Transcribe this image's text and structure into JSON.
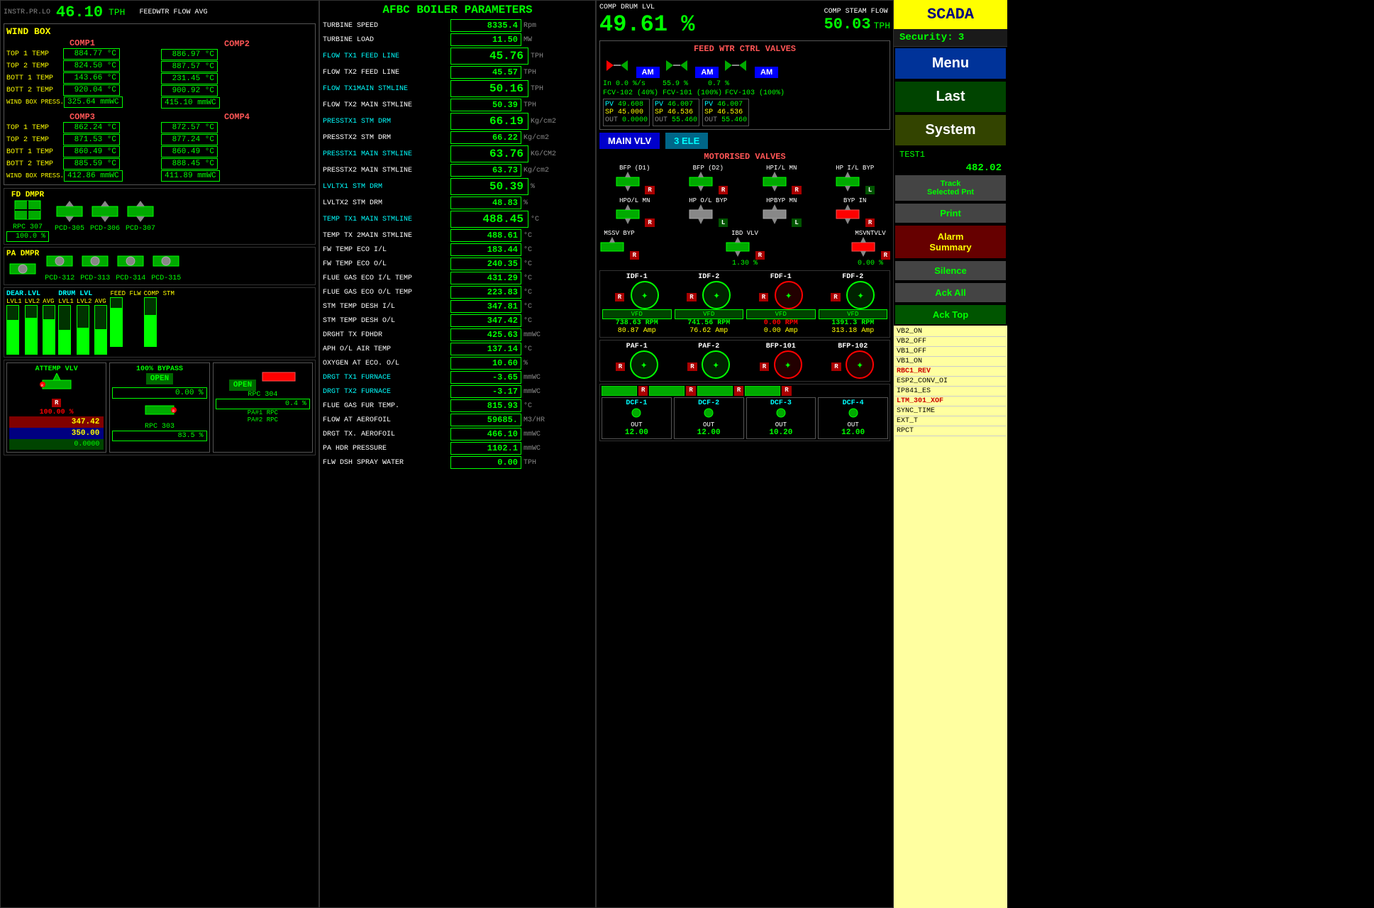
{
  "header": {
    "instr_label": "INSTR.PR.LO",
    "tph_value": "46.10",
    "tph_unit": "TPH",
    "feedwtr_label": "FEEDWTR FLOW AVG"
  },
  "afbc_title": "AFBC BOILER PARAMETERS",
  "wind_box": {
    "title": "WIND BOX",
    "comp1": {
      "label": "COMP1",
      "top1_label": "TOP 1 TEMP",
      "top1_val": "884.77 °C",
      "top2_label": "TOP 2 TEMP",
      "top2_val": "824.50 °C",
      "bott1_label": "BOTT 1 TEMP",
      "bott1_val": "143.66 °C",
      "bott2_label": "BOTT 2 TEMP",
      "bott2_val": "920.04 °C",
      "press_label": "WIND BOX PRESS.",
      "press_val": "325.64 mmWC"
    },
    "comp2": {
      "label": "COMP2",
      "top1_val": "886.97 °C",
      "top2_val": "887.57 °C",
      "bott1_val": "231.45 °C",
      "bott2_val": "900.92 °C",
      "press_val": "415.10 mmWC"
    },
    "comp3": {
      "label": "COMP3",
      "top1_val": "862.24 °C",
      "top2_val": "871.53 °C",
      "bott1_val": "860.49 °C",
      "bott2_val": "885.59 °C",
      "press_val": "412.86 mmWC"
    },
    "comp4": {
      "label": "COMP4",
      "top1_val": "872.57 °C",
      "top2_val": "877.24 °C",
      "bott1_val": "860.49 °C",
      "bott2_val": "888.45 °C",
      "press_val": "411.89 mmWC"
    }
  },
  "dampers": {
    "fd_label": "FD DMPR",
    "rpc307_label": "RPC 307",
    "rpc307_val": "100.0 %",
    "pcd305_label": "PCD-305",
    "pcd306_label": "PCD-306",
    "pcd307_label": "PCD-307",
    "pa_label": "PA DMPR",
    "pcd312_label": "PCD-312",
    "pcd313_label": "PCD-313",
    "pcd314_label": "PCD-314",
    "pcd315_label": "PCD-315"
  },
  "levels": {
    "dear_lvl": "DEAR.LVL",
    "drum_lvl": "DRUM LVL",
    "feed_flw": "FEED FLW",
    "comp_stm": "COMP STM",
    "lvl1": "LVL1",
    "lvl2": "LVL2",
    "avg": "AVG"
  },
  "attemp": {
    "vlv_label": "ATTEMP VLV",
    "bypass_label": "100% BYPASS",
    "bypass_val": "0.00 %",
    "open1_label": "OPEN",
    "open2_label": "OPEN",
    "pv_val": "347.42",
    "sp_val": "350.00",
    "out_val": "0.0000",
    "rpc303_label": "RPC 303",
    "rpc303_val": "83.5 %",
    "rpc304_label": "RPC 304",
    "rpc304_val": "0.4 %",
    "pa1_label": "PA#1 RPC",
    "pa2_label": "PA#2 RPC"
  },
  "params": [
    {
      "label": "TURBINE SPEED",
      "value": "8335.4",
      "unit": "Rpm",
      "cyan": false
    },
    {
      "label": "TURBINE LOAD",
      "value": "11.50",
      "unit": "MW",
      "cyan": false
    },
    {
      "label": "FLOW TX1 FEED LINE",
      "value": "45.76",
      "unit": "TPH",
      "cyan": true,
      "large": true
    },
    {
      "label": "FLOW TX2 FEED LINE",
      "value": "45.57",
      "unit": "TPH",
      "cyan": false
    },
    {
      "label": "FLOW TX1MAIN STMLINE",
      "value": "50.16",
      "unit": "TPH",
      "cyan": true,
      "large": true
    },
    {
      "label": "FLOW TX2 MAIN STMLINE",
      "value": "50.39",
      "unit": "TPH",
      "cyan": false
    },
    {
      "label": "PRESSTX1 STM DRM",
      "value": "66.19",
      "unit": "Kg/cm2",
      "cyan": true,
      "large": true
    },
    {
      "label": "PRESSTX2 STM DRM",
      "value": "66.22",
      "unit": "Kg/cm2",
      "cyan": false
    },
    {
      "label": "PRESSTX1 MAIN STMLINE",
      "value": "63.76",
      "unit": "KG/CM2",
      "cyan": true,
      "large": true
    },
    {
      "label": "PRESSTX2 MAIN STMLINE",
      "value": "63.73",
      "unit": "Kg/cm2",
      "cyan": false
    },
    {
      "label": "LVLTX1 STM DRM",
      "value": "50.39",
      "unit": "%",
      "cyan": true,
      "large": true
    },
    {
      "label": "LVLTX2 STM DRM",
      "value": "48.83",
      "unit": "%",
      "cyan": false
    },
    {
      "label": "TEMP TX1 MAIN STMLINE",
      "value": "488.45",
      "unit": "°C",
      "cyan": true,
      "large": true
    },
    {
      "label": "TEMP TX 2MAIN STMLINE",
      "value": "488.61",
      "unit": "°C",
      "cyan": false
    },
    {
      "label": "FW TEMP ECO I/L",
      "value": "183.44",
      "unit": "°C",
      "cyan": false
    },
    {
      "label": "FW TEMP ECO O/L",
      "value": "240.35",
      "unit": "°C",
      "cyan": false
    },
    {
      "label": "FLUE GAS ECO I/L TEMP",
      "value": "431.29",
      "unit": "°C",
      "cyan": false
    },
    {
      "label": "FLUE GAS ECO O/L TEMP",
      "value": "223.83",
      "unit": "°C",
      "cyan": false
    },
    {
      "label": "STM TEMP DESH I/L",
      "value": "347.81",
      "unit": "°C",
      "cyan": false
    },
    {
      "label": "STM TEMP DESH O/L",
      "value": "347.42",
      "unit": "°C",
      "cyan": false
    },
    {
      "label": "DRGHT TX FDHDR",
      "value": "425.63",
      "unit": "mmWC",
      "cyan": false
    },
    {
      "label": "APH O/L AIR TEMP",
      "value": "137.14",
      "unit": "°C",
      "cyan": false
    },
    {
      "label": "OXYGEN AT ECO. O/L",
      "value": "10.60",
      "unit": "%",
      "cyan": false
    },
    {
      "label": "DRGT TX1 FURNACE",
      "value": "-3.65",
      "unit": "mmWC",
      "cyan": true
    },
    {
      "label": "DRGT TX2 FURNACE",
      "value": "-3.17",
      "unit": "mmWC",
      "cyan": true
    },
    {
      "label": "FLUE GAS FUR TEMP.",
      "value": "815.93",
      "unit": "°C",
      "cyan": false
    },
    {
      "label": "FLOW AT AEROFOIL",
      "value": "59685.",
      "unit": "M3/HR",
      "cyan": false
    },
    {
      "label": "DRGT TX. AEROFOIL",
      "value": "466.10",
      "unit": "mmWC",
      "cyan": false
    },
    {
      "label": "PA HDR PRESSURE",
      "value": "1102.1",
      "unit": "mmWC",
      "cyan": false
    },
    {
      "label": "FLW DSH SPRAY WATER",
      "value": "0.00",
      "unit": "TPH",
      "cyan": false
    }
  ],
  "right_panel": {
    "comp_drum_lvl": "COMP DRUM LVL",
    "comp_steam_flow": "COMP STEAM FLOW",
    "big_percent": "49.61 %",
    "tph_value": "50.03",
    "tph_unit": "TPH",
    "feed_wtr_ctrl": "FEED WTR CTRL VALVES",
    "in_pct": "In 0.0 %/s",
    "pct_55": "55.9 %",
    "pct_07": "0.7 %",
    "fcv102_label": "FCV-102 (40%)",
    "fcv101_label": "FCV-101 (100%)",
    "fcv103_label": "FCV-103 (100%)",
    "fcv102": {
      "pv": "49.608",
      "sp": "45.000",
      "out": "0.0000"
    },
    "fcv101": {
      "pv": "46.007",
      "sp": "46.536",
      "out": "55.460"
    },
    "fcv103": {
      "pv": "46.007",
      "sp": "46.536",
      "out": "55.460"
    },
    "main_vlv_btn": "MAIN VLV",
    "three_ele_btn": "3 ELE",
    "motorised_title": "MOTORISED VALVES",
    "bfp_d1": "BFP (D1)",
    "bfp_d2": "BFP (D2)",
    "hpi_mn": "HPI/L MN",
    "hp_il_byp": "HP I/L BYP",
    "hpo_mn": "HPO/L MN",
    "hp_ol_byp": "HP O/L BYP",
    "hpbyp_mn": "HPBYP MN",
    "byp_in": "BYP IN",
    "mssv_byp": "MSSV BYP",
    "ibd_vlv": "IBD VLV",
    "msvntvlv": "MSVNTVLV",
    "ibd_pct": "1.30 %",
    "msvnt_pct": "0.00 %",
    "idf1_label": "IDF-1",
    "idf2_label": "IDF-2",
    "fdf1_label": "FDF-1",
    "fdf2_label": "FDF-2",
    "idf1_rpm": "738.63 RPM",
    "idf2_rpm": "741.56 RPM",
    "fdf1_rpm": "0.00 RPM",
    "fdf2_rpm": "1391.3 RPM",
    "idf1_amp": "80.87 Amp",
    "idf2_amp": "76.62 Amp",
    "fdf1_amp": "0.00 Amp",
    "fdf2_amp": "313.18 Amp",
    "paf1_label": "PAF-1",
    "paf2_label": "PAF-2",
    "bfp101_label": "BFP-101",
    "bfp102_label": "BFP-102",
    "dcf1_label": "DCF-1",
    "dcf2_label": "DCF-2",
    "dcf3_label": "DCF-3",
    "dcf4_label": "DCF-4",
    "dcf1_out": "12.00",
    "dcf2_out": "12.00",
    "dcf3_out": "10.20",
    "dcf4_out": "12.00"
  },
  "scada": {
    "title": "SCADA",
    "security_label": "Security:",
    "security_val": "3",
    "menu_btn": "Menu",
    "last_btn": "Last",
    "system_btn": "System",
    "test1_label": "TEST1",
    "test1_val": "482.02",
    "track_btn": "Track\nSelected Pnt",
    "print_btn": "Print",
    "alarm_summary_btn": "Alarm\nSummary",
    "silence_btn": "Silence",
    "ack_all_btn": "Ack All",
    "ack_top_btn": "Ack Top",
    "alarms": [
      {
        "text": "VB2_ON",
        "type": "normal"
      },
      {
        "text": "VB2_OFF",
        "type": "normal"
      },
      {
        "text": "VB1_OFF",
        "type": "normal"
      },
      {
        "text": "VB1_ON",
        "type": "normal"
      },
      {
        "text": "RBC1_REV",
        "type": "red"
      },
      {
        "text": "ESP2_CONV_OI",
        "type": "normal"
      },
      {
        "text": "IP841_ES",
        "type": "normal"
      },
      {
        "text": "LTM_301_XOF",
        "type": "red"
      },
      {
        "text": "SYNC_TIME",
        "type": "normal"
      },
      {
        "text": "EXT_T",
        "type": "normal"
      },
      {
        "text": "RPCT",
        "type": "normal"
      }
    ]
  }
}
